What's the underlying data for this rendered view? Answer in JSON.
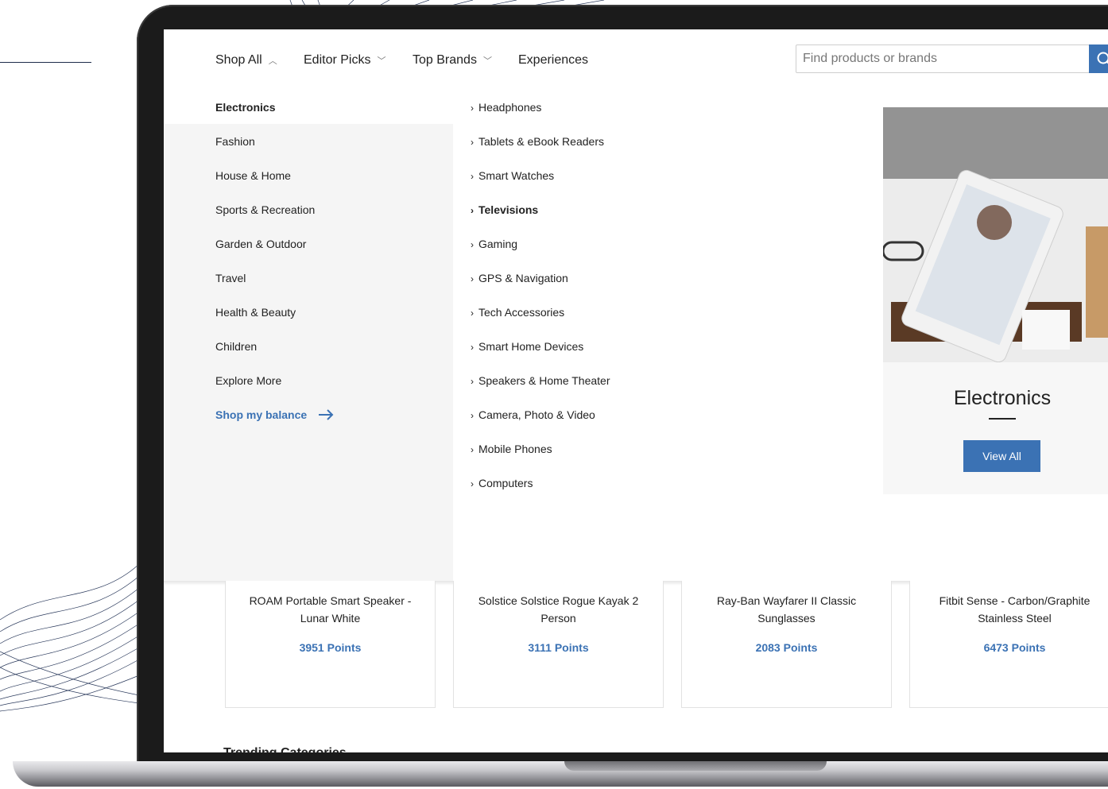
{
  "nav": {
    "items": [
      {
        "label": "Shop All",
        "chevron": "up"
      },
      {
        "label": "Editor Picks",
        "chevron": "down"
      },
      {
        "label": "Top Brands",
        "chevron": "down"
      },
      {
        "label": "Experiences"
      }
    ],
    "search_placeholder": "Find products or brands",
    "search_icon": "search-icon"
  },
  "categories": [
    {
      "label": "Electronics",
      "active": true
    },
    {
      "label": "Fashion"
    },
    {
      "label": "House & Home"
    },
    {
      "label": "Sports & Recreation"
    },
    {
      "label": "Garden & Outdoor"
    },
    {
      "label": "Travel"
    },
    {
      "label": "Health & Beauty"
    },
    {
      "label": "Children"
    },
    {
      "label": "Explore More"
    }
  ],
  "shop_balance": {
    "label": "Shop my balance",
    "icon": "arrow-right-icon"
  },
  "subcategories": [
    {
      "label": "Headphones"
    },
    {
      "label": "Tablets & eBook Readers"
    },
    {
      "label": "Smart Watches"
    },
    {
      "label": "Televisions",
      "bold": true
    },
    {
      "label": "Gaming"
    },
    {
      "label": "GPS & Navigation"
    },
    {
      "label": "Tech Accessories"
    },
    {
      "label": "Smart Home Devices"
    },
    {
      "label": "Speakers & Home Theater"
    },
    {
      "label": "Camera, Photo & Video"
    },
    {
      "label": "Mobile Phones"
    },
    {
      "label": "Computers"
    }
  ],
  "promo": {
    "title": "Electronics",
    "button": "View All"
  },
  "products": [
    {
      "name": "ROAM Portable Smart Speaker - Lunar White",
      "points": "3951 Points"
    },
    {
      "name": "Solstice Solstice Rogue Kayak 2 Person",
      "points": "3111 Points"
    },
    {
      "name": "Ray-Ban Wayfarer II Classic Sunglasses",
      "points": "2083 Points"
    },
    {
      "name": "Fitbit Sense - Carbon/Graphite Stainless Steel",
      "points": "6473 Points"
    }
  ],
  "trending_heading": "Trending Categories",
  "colors": {
    "accent": "#3b72b4",
    "menu_bg": "#f5f5f5"
  }
}
